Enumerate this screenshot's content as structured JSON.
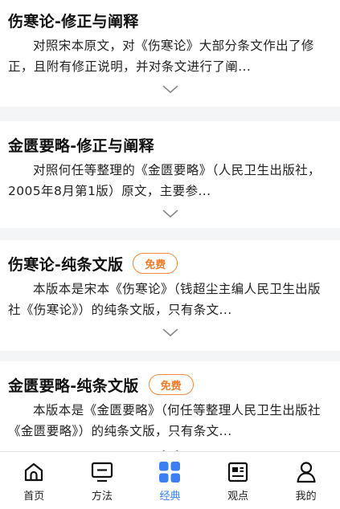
{
  "cards": [
    {
      "title": "伤寒论-修正与阐释",
      "badge": "",
      "desc": "对照宋本原文，对《伤寒论》大部分条文作出了修正，且附有修正说明，并对条文进行了阐..."
    },
    {
      "title": "金匮要略-修正与阐释",
      "badge": "",
      "desc": "对照何任等整理的《金匮要略》（人民卫生出版社，2005年8月第1版）原文，主要参..."
    },
    {
      "title": "伤寒论-纯条文版",
      "badge": "免费",
      "desc": "本版本是宋本《伤寒论》（钱超尘主编人民卫生出版社《伤寒论》）的纯条文版，只有条文..."
    },
    {
      "title": "金匮要略-纯条文版",
      "badge": "免费",
      "desc": "本版本是《金匮要略》（何任等整理人民卫生出版社《金匮要略》）的纯条文版，只有条文..."
    }
  ],
  "tabbar": {
    "items": [
      {
        "label": "首页",
        "icon": "home-icon",
        "active": false
      },
      {
        "label": "方法",
        "icon": "monitor-icon",
        "active": false
      },
      {
        "label": "经典",
        "icon": "grid-icon",
        "active": true
      },
      {
        "label": "观点",
        "icon": "id-card-icon",
        "active": false
      },
      {
        "label": "我的",
        "icon": "user-icon",
        "active": false
      }
    ]
  },
  "colors": {
    "accent": "#3b7ff2",
    "badge": "#ef7c28",
    "background": "#f4f5f7"
  }
}
